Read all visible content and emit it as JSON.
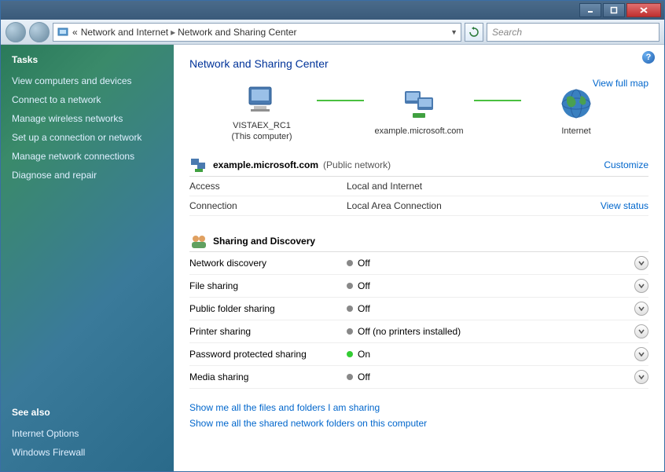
{
  "titlebar": {},
  "address": {
    "crumb_chevrons": "«",
    "crumb1": "Network and Internet",
    "crumb2": "Network and Sharing Center"
  },
  "search": {
    "placeholder": "Search"
  },
  "sidebar": {
    "tasks_header": "Tasks",
    "tasks": [
      "View computers and devices",
      "Connect to a network",
      "Manage wireless networks",
      "Set up a connection or network",
      "Manage network connections",
      "Diagnose and repair"
    ],
    "seealso_header": "See also",
    "seealso": [
      "Internet Options",
      "Windows Firewall"
    ]
  },
  "page": {
    "title": "Network and Sharing Center",
    "view_full_map": "View full map",
    "nodes": {
      "computer": {
        "name": "VISTAEX_RC1",
        "sub": "(This computer)"
      },
      "network": {
        "name": "example.microsoft.com"
      },
      "internet": {
        "name": "Internet"
      }
    },
    "network": {
      "name": "example.microsoft.com",
      "type": "(Public network)",
      "customize": "Customize",
      "rows": [
        {
          "k": "Access",
          "v": "Local and Internet"
        },
        {
          "k": "Connection",
          "v": "Local Area Connection",
          "link": "View status"
        }
      ]
    },
    "sharing": {
      "header": "Sharing and Discovery",
      "rows": [
        {
          "k": "Network discovery",
          "v": "Off",
          "on": false
        },
        {
          "k": "File sharing",
          "v": "Off",
          "on": false
        },
        {
          "k": "Public folder sharing",
          "v": "Off",
          "on": false
        },
        {
          "k": "Printer sharing",
          "v": "Off (no printers installed)",
          "on": false
        },
        {
          "k": "Password protected sharing",
          "v": "On",
          "on": true
        },
        {
          "k": "Media sharing",
          "v": "Off",
          "on": false
        }
      ]
    },
    "bottom_links": [
      "Show me all the files and folders I am sharing",
      "Show me all the shared network folders on this computer"
    ]
  }
}
